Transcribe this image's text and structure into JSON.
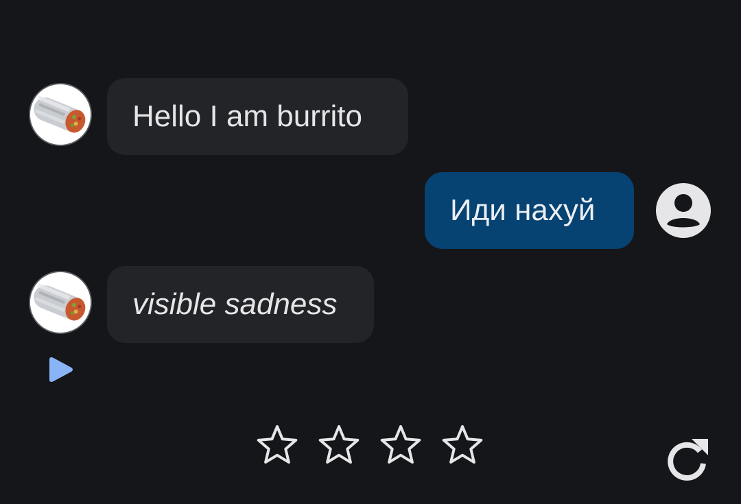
{
  "messages": [
    {
      "sender": "bot",
      "text": "Hello I am burrito",
      "style": "normal"
    },
    {
      "sender": "user",
      "text": "Иди нахуй",
      "style": "normal"
    },
    {
      "sender": "bot",
      "text": "visible sadness",
      "style": "italic"
    }
  ],
  "rating": {
    "max_stars": 4,
    "selected": 0
  },
  "icons": {
    "bot_avatar": "burrito-avatar-icon",
    "user_avatar": "user-account-icon",
    "play": "play-icon",
    "star": "star-outline-icon",
    "regenerate": "refresh-icon"
  },
  "colors": {
    "background": "#151619",
    "bot_bubble": "#232428",
    "user_bubble": "#064272",
    "play_accent": "#8ab4f8",
    "icon_light": "#e6e6e8"
  }
}
